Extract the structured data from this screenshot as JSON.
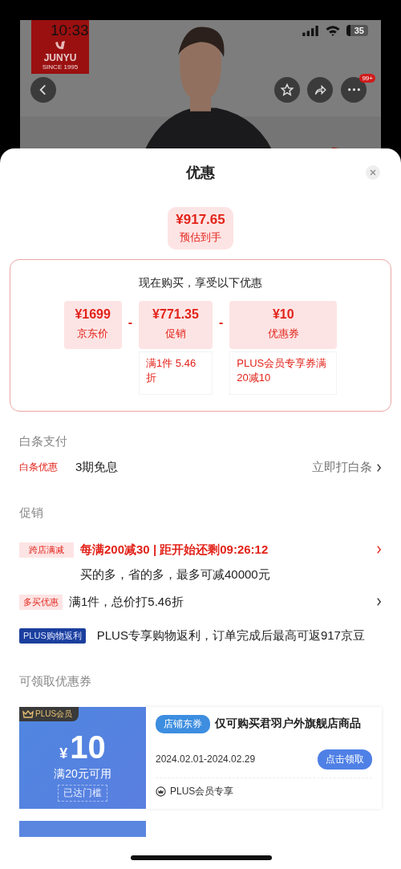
{
  "status_bar": {
    "time": "10:33",
    "battery": "35"
  },
  "header": {
    "logo": {
      "brand": "JUNYU",
      "since": "SINCE 1995"
    },
    "badge": "99+"
  },
  "sheet": {
    "title": "优惠"
  },
  "estimate": {
    "price": "¥917.65",
    "label": "预估到手"
  },
  "breakdown": {
    "heading": "现在购买，享受以下优惠",
    "items": [
      {
        "amount": "¥1699",
        "label": "京东价"
      },
      {
        "operator": "-",
        "amount": "¥771.35",
        "label": "促销",
        "note": "满1件 5.46折"
      },
      {
        "operator": "-",
        "amount": "¥10",
        "label": "优惠券",
        "note": "PLUS会员专享券满20减10"
      }
    ]
  },
  "baitiao": {
    "heading": "白条支付",
    "tag": "白条优惠",
    "text": "3期免息",
    "action": "立即打白条"
  },
  "promotions": {
    "heading": "促销",
    "items": [
      {
        "kind": "highlight",
        "tag": "跨店满减",
        "title": "每满200减30 | 距开始还剩09:26:12",
        "detail": "买的多，省的多，最多可减40000元"
      },
      {
        "kind": "plain",
        "tag": "多买优惠",
        "title": "满1件，总价打5.46折"
      },
      {
        "kind": "plus",
        "tag": "PLUS购物返利",
        "title": "PLUS专享购物返利，订单完成后最高可返917京豆"
      }
    ]
  },
  "coupons": {
    "heading": "可领取优惠券",
    "items": [
      {
        "badge": "PLUS会员",
        "currency": "¥",
        "amount": "10",
        "condition": "满20元可用",
        "threshold": "已达门槛",
        "type_tag": "店铺东券",
        "scope": "仅可购买君羽户外旗舰店商品",
        "validity": "2024.02.01-2024.02.29",
        "button": "点击领取",
        "member_note": "PLUS会员专享"
      }
    ]
  }
}
